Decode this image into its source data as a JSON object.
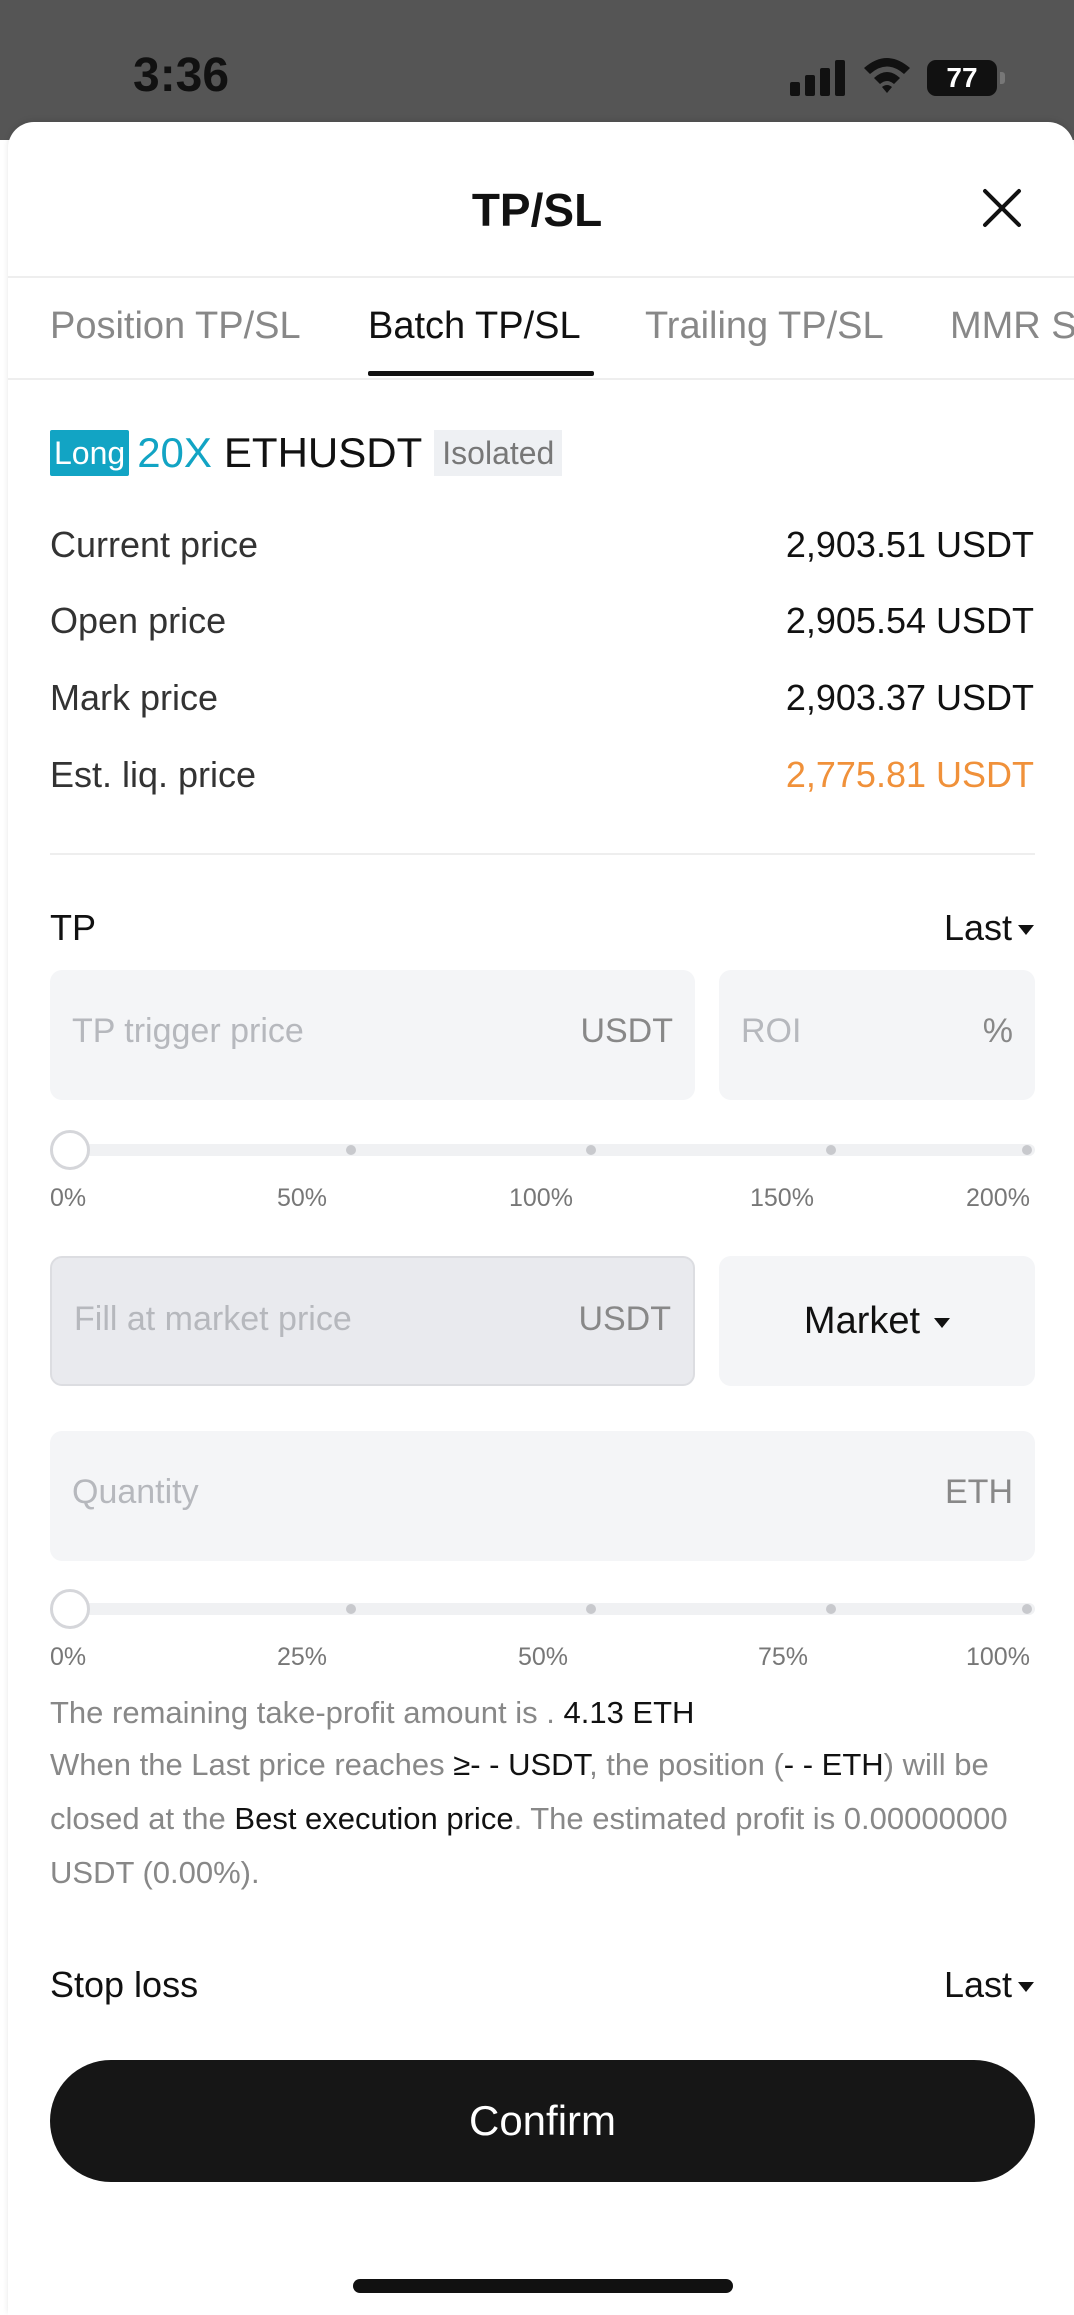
{
  "status_bar": {
    "time": "3:36",
    "battery": "77"
  },
  "header": {
    "title": "TP/SL"
  },
  "tabs": [
    {
      "label": "Position TP/SL",
      "active": false
    },
    {
      "label": "Batch TP/SL",
      "active": true
    },
    {
      "label": "Trailing TP/SL",
      "active": false
    },
    {
      "label": "MMR S",
      "active": false
    }
  ],
  "position": {
    "side": "Long",
    "leverage": "20X",
    "symbol": "ETHUSDT",
    "margin_mode": "Isolated"
  },
  "prices": [
    {
      "label": "Current price",
      "value": "2,903.51 USDT"
    },
    {
      "label": "Open price",
      "value": "2,905.54 USDT"
    },
    {
      "label": "Mark price",
      "value": "2,903.37 USDT"
    },
    {
      "label": "Est. liq. price",
      "value": "2,775.81 USDT"
    }
  ],
  "colors": {
    "accent": "#12a4c4",
    "liq": "#f0913a",
    "button": "#161616"
  },
  "tp": {
    "label": "TP",
    "trigger_type": "Last",
    "trigger_placeholder": "TP trigger price",
    "trigger_unit": "USDT",
    "roi_placeholder": "ROI",
    "roi_unit": "%",
    "roi_slider_ticks": [
      "0%",
      "50%",
      "100%",
      "150%",
      "200%"
    ],
    "roi_slider_value": 0,
    "order_price_placeholder": "Fill at market price",
    "order_price_unit": "USDT",
    "order_type": "Market",
    "quantity_placeholder": "Quantity",
    "quantity_unit": "ETH",
    "quantity_slider_ticks": [
      "0%",
      "25%",
      "50%",
      "75%",
      "100%"
    ],
    "quantity_slider_value": 0,
    "remaining_text": "The remaining take-profit amount is .",
    "remaining_value": "4.13 ETH",
    "desc_part1": "When the Last price reaches ",
    "desc_trigger": "≥- - USDT",
    "desc_part2": ", the position (",
    "desc_qty": "- - ETH",
    "desc_part3": ") will be closed at the ",
    "desc_exec": "Best execution price",
    "desc_part4": ". The estimated profit is 0.00000000 USDT (0.00%)."
  },
  "sl": {
    "label": "Stop loss",
    "trigger_type": "Last"
  },
  "confirm_label": "Confirm"
}
